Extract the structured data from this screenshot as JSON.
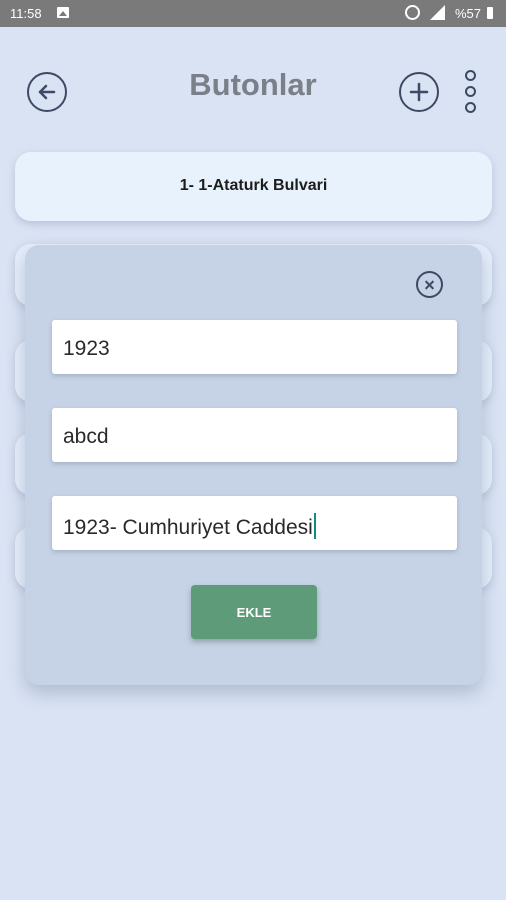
{
  "statusbar": {
    "time": "11:58",
    "battery": "%57",
    "icons": [
      "image-icon",
      "alarm-icon",
      "signal-icon",
      "battery-icon"
    ]
  },
  "header": {
    "title": "Butonlar",
    "back_icon": "arrow-left-icon",
    "add_icon": "plus-icon",
    "menu_icon": "kebab-menu-icon"
  },
  "list": {
    "items": [
      {
        "label": "1- 1-Ataturk Bulvari"
      }
    ]
  },
  "dialog": {
    "close_icon": "close-icon",
    "fields": [
      {
        "value": "1923"
      },
      {
        "value": "abcd"
      },
      {
        "value": "1923- Cumhuriyet Caddesi"
      }
    ],
    "submit_label": "EKLE"
  },
  "colors": {
    "background": "#d9e3f4",
    "card": "#e8f2fd",
    "dialog": "#c6d3e7",
    "button": "#5e9b78",
    "icon": "#3d4a63"
  }
}
